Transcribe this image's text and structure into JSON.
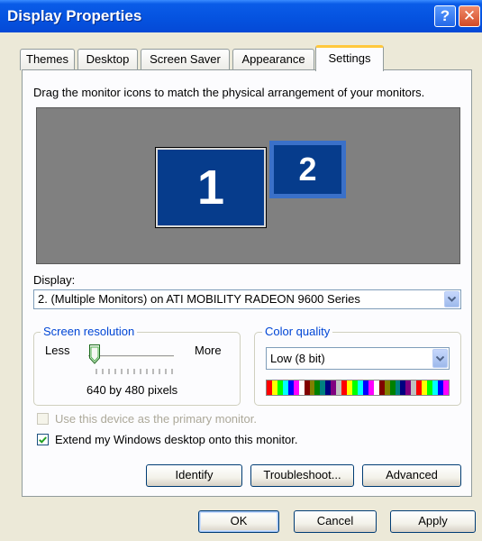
{
  "window": {
    "title": "Display Properties",
    "help_glyph": "?",
    "close_glyph": "✕"
  },
  "tabs": [
    {
      "label": "Themes",
      "active": false
    },
    {
      "label": "Desktop",
      "active": false
    },
    {
      "label": "Screen Saver",
      "active": false
    },
    {
      "label": "Appearance",
      "active": false
    },
    {
      "label": "Settings",
      "active": true
    }
  ],
  "settings": {
    "instruction": "Drag the monitor icons to match the physical arrangement of your monitors.",
    "monitors": [
      {
        "number": "1",
        "selected": false
      },
      {
        "number": "2",
        "selected": true
      }
    ],
    "display_label": "Display:",
    "display_value": "2. (Multiple Monitors) on ATI MOBILITY RADEON 9600 Series",
    "resolution": {
      "group_title": "Screen resolution",
      "less_label": "Less",
      "more_label": "More",
      "value_text": "640 by 480 pixels",
      "slider_position": 0
    },
    "color_quality": {
      "group_title": "Color quality",
      "selected": "Low (8 bit)",
      "palette": [
        "#FF0000",
        "#FFFF00",
        "#00FF00",
        "#00FFFF",
        "#0000FF",
        "#FF00FF",
        "#FFFFFF",
        "#800000",
        "#808000",
        "#008000",
        "#008080",
        "#000080",
        "#800080",
        "#C0C0C0",
        "#FF0000",
        "#FFFF00",
        "#00FF00",
        "#00FFFF",
        "#0000FF",
        "#FF00FF",
        "#FFFFFF",
        "#800000",
        "#808000",
        "#008000",
        "#008080",
        "#000080",
        "#800080",
        "#C0C0C0",
        "#FF0000",
        "#FFFF00",
        "#00FF00",
        "#00FFFF",
        "#0000FF",
        "#FF00FF"
      ]
    },
    "primary_monitor": {
      "label": "Use this device as the primary monitor.",
      "checked": false,
      "enabled": false
    },
    "extend_desktop": {
      "label": "Extend my Windows desktop onto this monitor.",
      "checked": true,
      "enabled": true
    },
    "buttons": {
      "identify": "Identify",
      "troubleshoot": "Troubleshoot...",
      "advanced": "Advanced"
    }
  },
  "footer": {
    "ok": "OK",
    "cancel": "Cancel",
    "apply": "Apply"
  },
  "colors": {
    "title_bar": "#0553E0",
    "monitor_bg": "#808080",
    "monitor_fill": "#063C8C",
    "group_title": "#0046D5",
    "tab_highlight": "#FFC83C"
  },
  "icons": [
    "help-icon",
    "close-icon",
    "chevron-down-icon",
    "slider-thumb-icon",
    "checkmark-icon"
  ]
}
